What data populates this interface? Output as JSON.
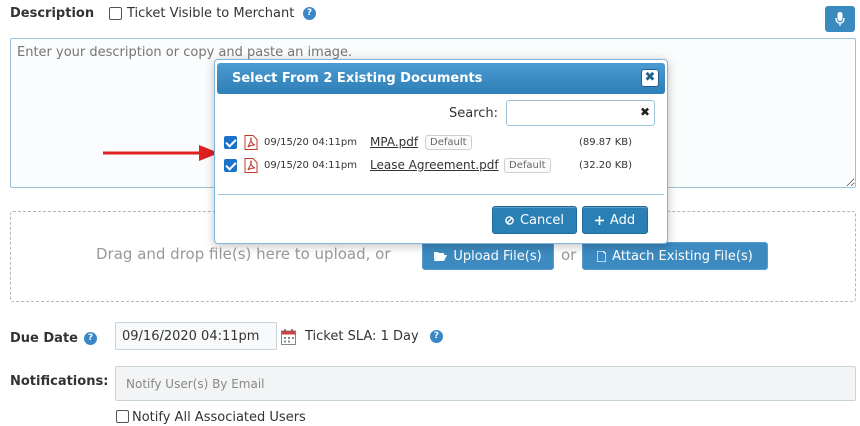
{
  "form": {
    "description_label": "Description",
    "visible_to_merchant_label": "Ticket Visible to Merchant",
    "description_placeholder": "Enter your description or copy and paste an image.",
    "dropzone_text": "Drag and drop file(s) here to upload, or",
    "upload_button": "Upload File(s)",
    "or_text": "or",
    "attach_existing_button": "Attach Existing File(s)",
    "due_date_label": "Due Date",
    "due_date_value": "09/16/2020 04:11pm",
    "ticket_sla_text": "Ticket SLA: 1 Day",
    "notifications_label": "Notifications:",
    "notify_placeholder": "Notify User(s) By Email",
    "notify_all_label": "Notify All Associated Users",
    "help_glyph": "?"
  },
  "modal": {
    "title": "Select From 2 Existing Documents",
    "close_glyph": "✖",
    "search_label": "Search:",
    "search_value": "",
    "search_clear_glyph": "✖",
    "documents": [
      {
        "checked": true,
        "date": "09/15/20 04:11pm",
        "name": "MPA.pdf",
        "badge": "Default",
        "size": "(89.87 KB)"
      },
      {
        "checked": true,
        "date": "09/15/20 04:11pm",
        "name": "Lease Agreement.pdf",
        "badge": "Default",
        "size": "(32.20 KB)"
      }
    ],
    "cancel_button": "Cancel",
    "add_button": "Add"
  },
  "colors": {
    "accent": "#2a7fb5",
    "arrow": "#e02020"
  },
  "icons": [
    "help-icon",
    "microphone-icon",
    "pdf-icon",
    "calendar-icon",
    "folder-open-icon",
    "file-icon",
    "cancel-icon",
    "plus-icon",
    "close-icon"
  ]
}
